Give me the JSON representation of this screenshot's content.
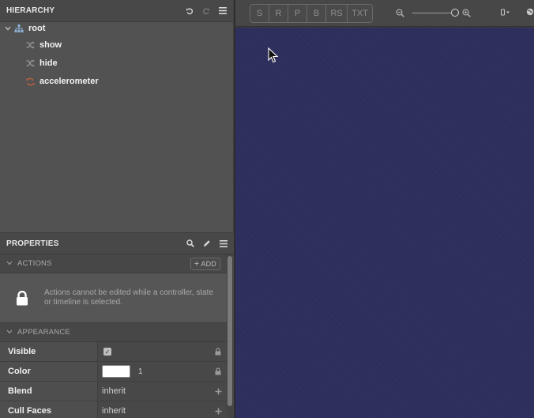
{
  "hierarchy": {
    "title": "HIERARCHY",
    "icons": [
      "undo-icon",
      "redo-icon",
      "menu-icon"
    ],
    "items": [
      {
        "label": "root",
        "icon": "hierarchy-icon",
        "expanded": true
      },
      {
        "label": "show",
        "icon": "shuffle-icon"
      },
      {
        "label": "hide",
        "icon": "shuffle-icon"
      },
      {
        "label": "accelerometer",
        "icon": "refresh-icon",
        "icon_color": "#c0603e"
      }
    ]
  },
  "properties": {
    "title": "PROPERTIES",
    "icons": [
      "search-icon",
      "pencil-icon",
      "menu-icon"
    ],
    "actions": {
      "header": "ACTIONS",
      "add_label": "ADD",
      "message": "Actions cannot be edited while a controller, state or timeline is selected."
    },
    "appearance": {
      "header": "APPEARANCE",
      "rows": [
        {
          "name": "Visible",
          "checked": true
        },
        {
          "name": "Color",
          "swatch": "#ffffff",
          "alpha": "1"
        },
        {
          "name": "Blend",
          "value": "inherit"
        },
        {
          "name": "Cull Faces",
          "value": "inherit"
        }
      ]
    }
  },
  "toolbar": {
    "buttons": [
      "S",
      "R",
      "P",
      "B",
      "RS",
      "TXT"
    ],
    "zoom_icons": [
      "zoom-out-icon",
      "zoom-in-icon"
    ],
    "zoom_level": 1.0,
    "right_icons": [
      "device-dropdown-icon",
      "globe-icon"
    ]
  },
  "viewport": {
    "background": "#2d2d5c"
  }
}
